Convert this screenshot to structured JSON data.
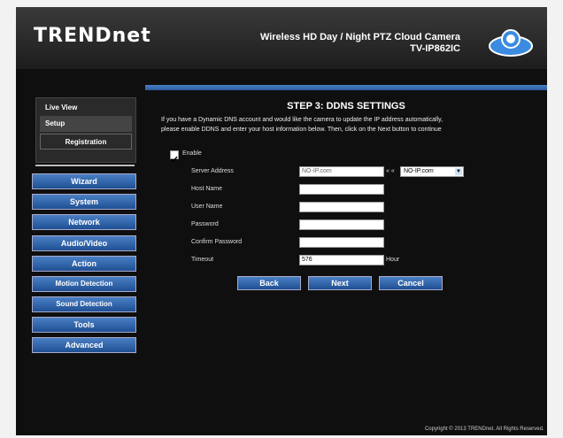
{
  "header": {
    "brand": "TRENDnet",
    "title_line1": "Wireless HD Day / Night PTZ Cloud Camera",
    "title_line2": "TV-IP862IC"
  },
  "nav_top": [
    {
      "label": "Live View"
    },
    {
      "label": "Setup"
    },
    {
      "label": "Registration"
    }
  ],
  "nav": [
    {
      "label": "Wizard"
    },
    {
      "label": "System"
    },
    {
      "label": "Network"
    },
    {
      "label": "Audio/Video"
    },
    {
      "label": "Action"
    },
    {
      "label": "Motion Detection"
    },
    {
      "label": "Sound Detection"
    },
    {
      "label": "Tools"
    },
    {
      "label": "Advanced"
    }
  ],
  "main": {
    "step_title": "STEP 3: DDNS SETTINGS",
    "intro_line1": "If you have a Dynamic DNS account and would like the camera to update the IP address automatically,",
    "intro_line2": "please enable DDNS and enter your host information below. Then, click on the Next button to continue",
    "enable_label": "Enable",
    "fields": [
      {
        "label": "Server Address",
        "value": "NO-IP.com"
      },
      {
        "label": "Host Name",
        "value": ""
      },
      {
        "label": "User Name",
        "value": ""
      },
      {
        "label": "Password",
        "value": ""
      },
      {
        "label": "Confirm Password",
        "value": ""
      },
      {
        "label": "Timeout",
        "value": "576"
      }
    ],
    "timeout_unit": "Hour",
    "server_select_value": "NO-IP.com",
    "buttons": {
      "back": "Back",
      "next": "Next",
      "cancel": "Cancel"
    }
  },
  "footer": "Copyright © 2013 TRENDnet. All Rights Reserved."
}
